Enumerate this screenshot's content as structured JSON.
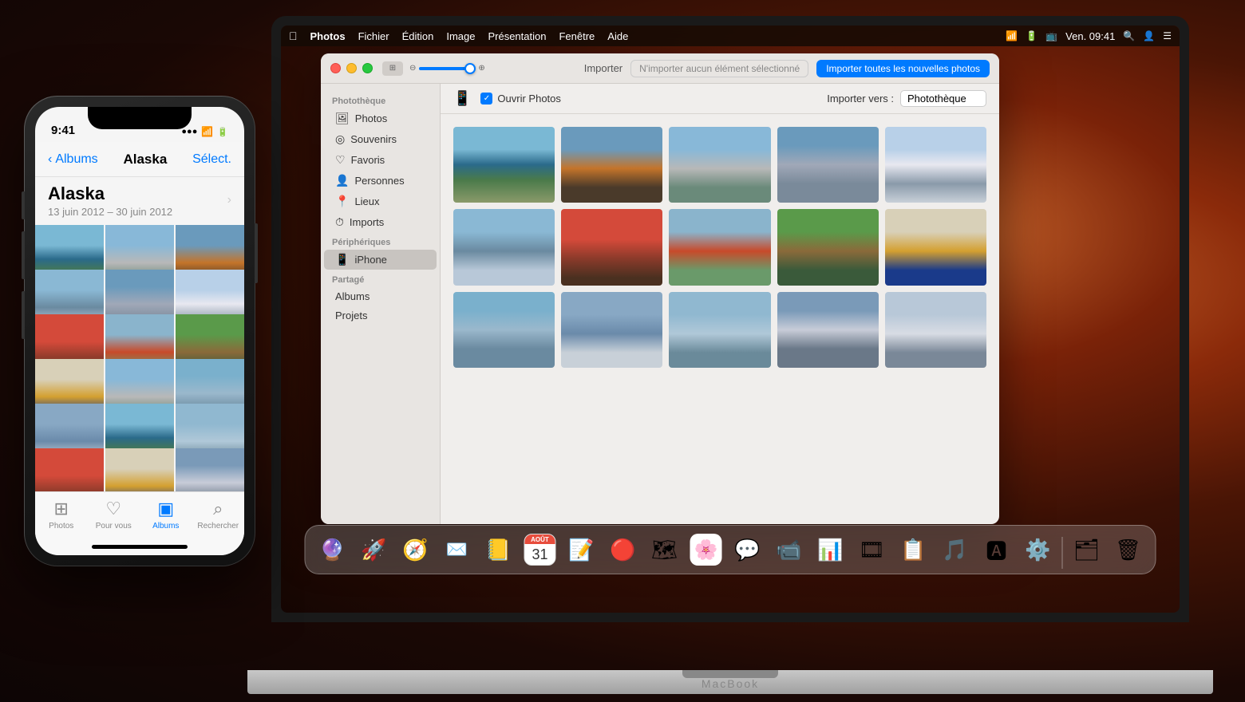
{
  "desktop": {
    "bg_desc": "macOS Mojave desert wallpaper"
  },
  "macbook": {
    "label": "MacBook"
  },
  "menubar": {
    "apple": "⌘",
    "app_name": "Photos",
    "menus": [
      "Fichier",
      "Édition",
      "Image",
      "Présentation",
      "Fenêtre",
      "Aide"
    ],
    "time": "Ven. 09:41",
    "wifi_icon": "wifi",
    "battery_icon": "battery",
    "airplay_icon": "airplay",
    "search_icon": "search",
    "user_icon": "user",
    "list_icon": "list"
  },
  "photos_window": {
    "titlebar": {
      "slider_label": "zoom-slider",
      "import_label": "Importer",
      "import_status": "N'importer aucun élément sélectionné",
      "import_btn": "Importer toutes les nouvelles photos"
    },
    "import_header": {
      "open_photos_label": "Ouvrir Photos",
      "import_to_label": "Importer vers :",
      "destination": "Photothèque"
    },
    "sidebar": {
      "section_phototheque": "Photothèque",
      "items_phototheque": [
        {
          "label": "Photos",
          "icon": "🖼",
          "active": false
        },
        {
          "label": "Souvenirs",
          "icon": "◎",
          "active": false
        },
        {
          "label": "Favoris",
          "icon": "♡",
          "active": false
        },
        {
          "label": "Personnes",
          "icon": "👤",
          "active": false
        },
        {
          "label": "Lieux",
          "icon": "📍",
          "active": false
        },
        {
          "label": "Imports",
          "icon": "⏱",
          "active": false
        }
      ],
      "section_peripheriques": "Périphériques",
      "items_peripheriques": [
        {
          "label": "iPhone",
          "icon": "📱",
          "active": true
        }
      ],
      "section_partage": "Partagé",
      "items_partage": [
        {
          "label": "Albums",
          "icon": "",
          "active": false
        },
        {
          "label": "Projets",
          "icon": "",
          "active": false
        }
      ]
    },
    "photos": [
      {
        "id": "p1",
        "class": "p1"
      },
      {
        "id": "p2",
        "class": "p2"
      },
      {
        "id": "p3",
        "class": "p3"
      },
      {
        "id": "p4",
        "class": "p4"
      },
      {
        "id": "p5",
        "class": "p5"
      },
      {
        "id": "p6",
        "class": "p6"
      },
      {
        "id": "p7",
        "class": "p7"
      },
      {
        "id": "p8",
        "class": "p8"
      },
      {
        "id": "p9",
        "class": "p9"
      },
      {
        "id": "p10",
        "class": "p10"
      },
      {
        "id": "p11",
        "class": "p11"
      },
      {
        "id": "p12",
        "class": "p12"
      },
      {
        "id": "p13",
        "class": "p13"
      },
      {
        "id": "p14",
        "class": "p14"
      },
      {
        "id": "p15",
        "class": "p15"
      }
    ]
  },
  "iphone": {
    "time": "9:41",
    "nav_back": "Albums",
    "nav_title": "Alaska",
    "nav_action": "Sélect.",
    "album_name": "Alaska",
    "album_date": "13 juin 2012 – 30 juin 2012",
    "tabs": [
      {
        "label": "Photos",
        "icon": "⊞",
        "active": false
      },
      {
        "label": "Pour vous",
        "icon": "♡",
        "active": false
      },
      {
        "label": "Albums",
        "icon": "▣",
        "active": true
      },
      {
        "label": "Rechercher",
        "icon": "⌕",
        "active": false
      }
    ],
    "photos": [
      {
        "class": "p1"
      },
      {
        "class": "p3"
      },
      {
        "class": "p2"
      },
      {
        "class": "p6"
      },
      {
        "class": "p4"
      },
      {
        "class": "p5"
      },
      {
        "class": "p7"
      },
      {
        "class": "p8"
      },
      {
        "class": "p9"
      },
      {
        "class": "p10"
      },
      {
        "class": "p3"
      },
      {
        "class": "p11"
      },
      {
        "class": "p12"
      },
      {
        "class": "p1"
      },
      {
        "class": "p13"
      },
      {
        "class": "p7"
      },
      {
        "class": "p10"
      },
      {
        "class": "p14"
      }
    ]
  },
  "dock": {
    "apps": [
      {
        "name": "Siri",
        "icon": "🔮",
        "label": "siri"
      },
      {
        "name": "Launchpad",
        "icon": "🚀",
        "label": "launchpad"
      },
      {
        "name": "Safari",
        "icon": "🧭",
        "label": "safari"
      },
      {
        "name": "Mail",
        "icon": "✉️",
        "label": "mail"
      },
      {
        "name": "Contacts",
        "icon": "📒",
        "label": "contacts"
      },
      {
        "name": "Calendar",
        "icon": "📅",
        "label": "calendar"
      },
      {
        "name": "Notes",
        "icon": "📝",
        "label": "notes"
      },
      {
        "name": "Reminders",
        "icon": "🔴",
        "label": "reminders"
      },
      {
        "name": "Maps",
        "icon": "🗺",
        "label": "maps"
      },
      {
        "name": "Photos",
        "icon": "🌈",
        "label": "photos"
      },
      {
        "name": "Messages",
        "icon": "💬",
        "label": "messages"
      },
      {
        "name": "FaceTime",
        "icon": "📹",
        "label": "facetime"
      },
      {
        "name": "Numbers",
        "icon": "📊",
        "label": "numbers"
      },
      {
        "name": "Keynote",
        "icon": "🎞",
        "label": "keynote"
      },
      {
        "name": "Keynote2",
        "icon": "📋",
        "label": "keynote2"
      },
      {
        "name": "Music",
        "icon": "🎵",
        "label": "music"
      },
      {
        "name": "App Store",
        "icon": "🅰",
        "label": "appstore"
      },
      {
        "name": "System Prefs",
        "icon": "⚙️",
        "label": "systemprefs"
      },
      {
        "name": "Files",
        "icon": "🗂",
        "label": "files"
      },
      {
        "name": "Trash",
        "icon": "🗑",
        "label": "trash"
      }
    ]
  }
}
